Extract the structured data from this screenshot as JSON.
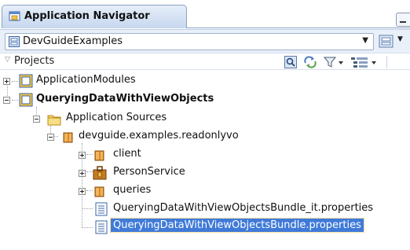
{
  "window": {
    "title": "Application Navigator"
  },
  "app_selector": {
    "value": "DevGuideExamples"
  },
  "projects_header": {
    "label": "Projects"
  },
  "tree": {
    "nodes": [
      {
        "label": "ApplicationModules",
        "icon": "project-folder-icon",
        "expanded": false
      },
      {
        "label": "QueryingDataWithViewObjects",
        "icon": "project-folder-icon",
        "expanded": true
      },
      {
        "label": "Application Sources",
        "icon": "folder-icon",
        "expanded": true
      },
      {
        "label": "devguide.examples.readonlyvo",
        "icon": "package-icon",
        "expanded": true
      },
      {
        "label": "client",
        "icon": "package-icon",
        "expanded": false
      },
      {
        "label": "PersonService",
        "icon": "app-module-icon",
        "expanded": false
      },
      {
        "label": "queries",
        "icon": "package-icon",
        "expanded": false
      },
      {
        "label": "QueryingDataWithViewObjectsBundle_it.properties",
        "icon": "properties-file-icon"
      },
      {
        "label": "QueryingDataWithViewObjectsBundle.properties",
        "icon": "properties-file-icon",
        "selected": true
      }
    ]
  },
  "colors": {
    "selection": "#3f7ad9",
    "tab_border": "#8aa3c4"
  }
}
